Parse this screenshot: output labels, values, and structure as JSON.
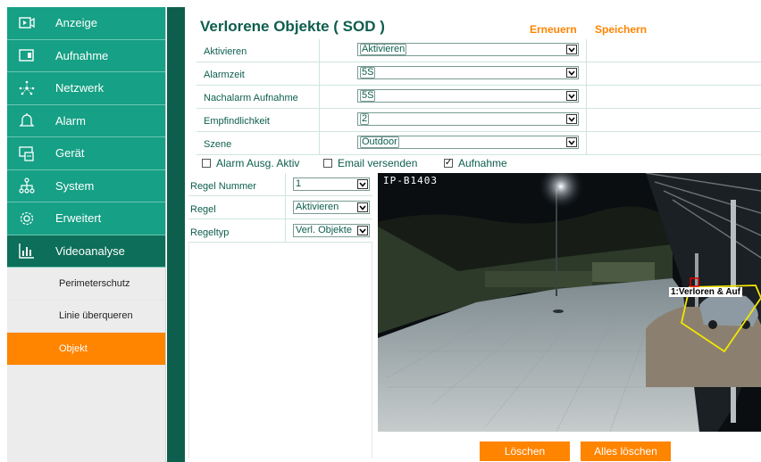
{
  "sidebar": {
    "items": [
      {
        "label": "Anzeige",
        "icon": "display-icon"
      },
      {
        "label": "Aufnahme",
        "icon": "recording-icon"
      },
      {
        "label": "Netzwerk",
        "icon": "network-icon"
      },
      {
        "label": "Alarm",
        "icon": "bell-icon"
      },
      {
        "label": "Gerät",
        "icon": "device-icon"
      },
      {
        "label": "System",
        "icon": "system-icon"
      },
      {
        "label": "Erweitert",
        "icon": "gear-icon"
      },
      {
        "label": "Videoanalyse",
        "icon": "bar-chart-icon",
        "active": true
      }
    ],
    "subitems": [
      {
        "label": "Perimeterschutz"
      },
      {
        "label": "Linie überqueren"
      },
      {
        "label": "Objekt",
        "active": true
      }
    ]
  },
  "header": {
    "title": "Verlorene Objekte ( SOD )",
    "renew_label": "Erneuern",
    "save_label": "Speichern"
  },
  "form": {
    "rows": [
      {
        "label": "Aktivieren",
        "value": "Aktivieren"
      },
      {
        "label": "Alarmzeit",
        "value": "5S"
      },
      {
        "label": "Nachalarm Aufnahme",
        "value": "5S"
      },
      {
        "label": "Empfindlichkeit",
        "value": "2"
      },
      {
        "label": "Szene",
        "value": "Outdoor"
      }
    ]
  },
  "checkboxes": [
    {
      "label": "Alarm Ausg. Aktiv",
      "checked": false
    },
    {
      "label": "Email versenden",
      "checked": false
    },
    {
      "label": "Aufnahme",
      "checked": true
    }
  ],
  "rules": {
    "rows": [
      {
        "label": "Regel Nummer",
        "value": "1"
      },
      {
        "label": "Regel",
        "value": "Aktivieren"
      },
      {
        "label": "Regeltyp",
        "value": "Verl. Objekte"
      }
    ]
  },
  "video": {
    "camera_label": "IP-B1403",
    "object_label": "1:Verloren & Auf",
    "region_color": "#f2e600"
  },
  "buttons": {
    "delete_label": "Löschen",
    "delete_all_label": "Alles löschen"
  },
  "colors": {
    "nav": "#16a085",
    "nav_active": "#0d6e59",
    "accent": "#ff8400",
    "title": "#0d5e4d"
  }
}
